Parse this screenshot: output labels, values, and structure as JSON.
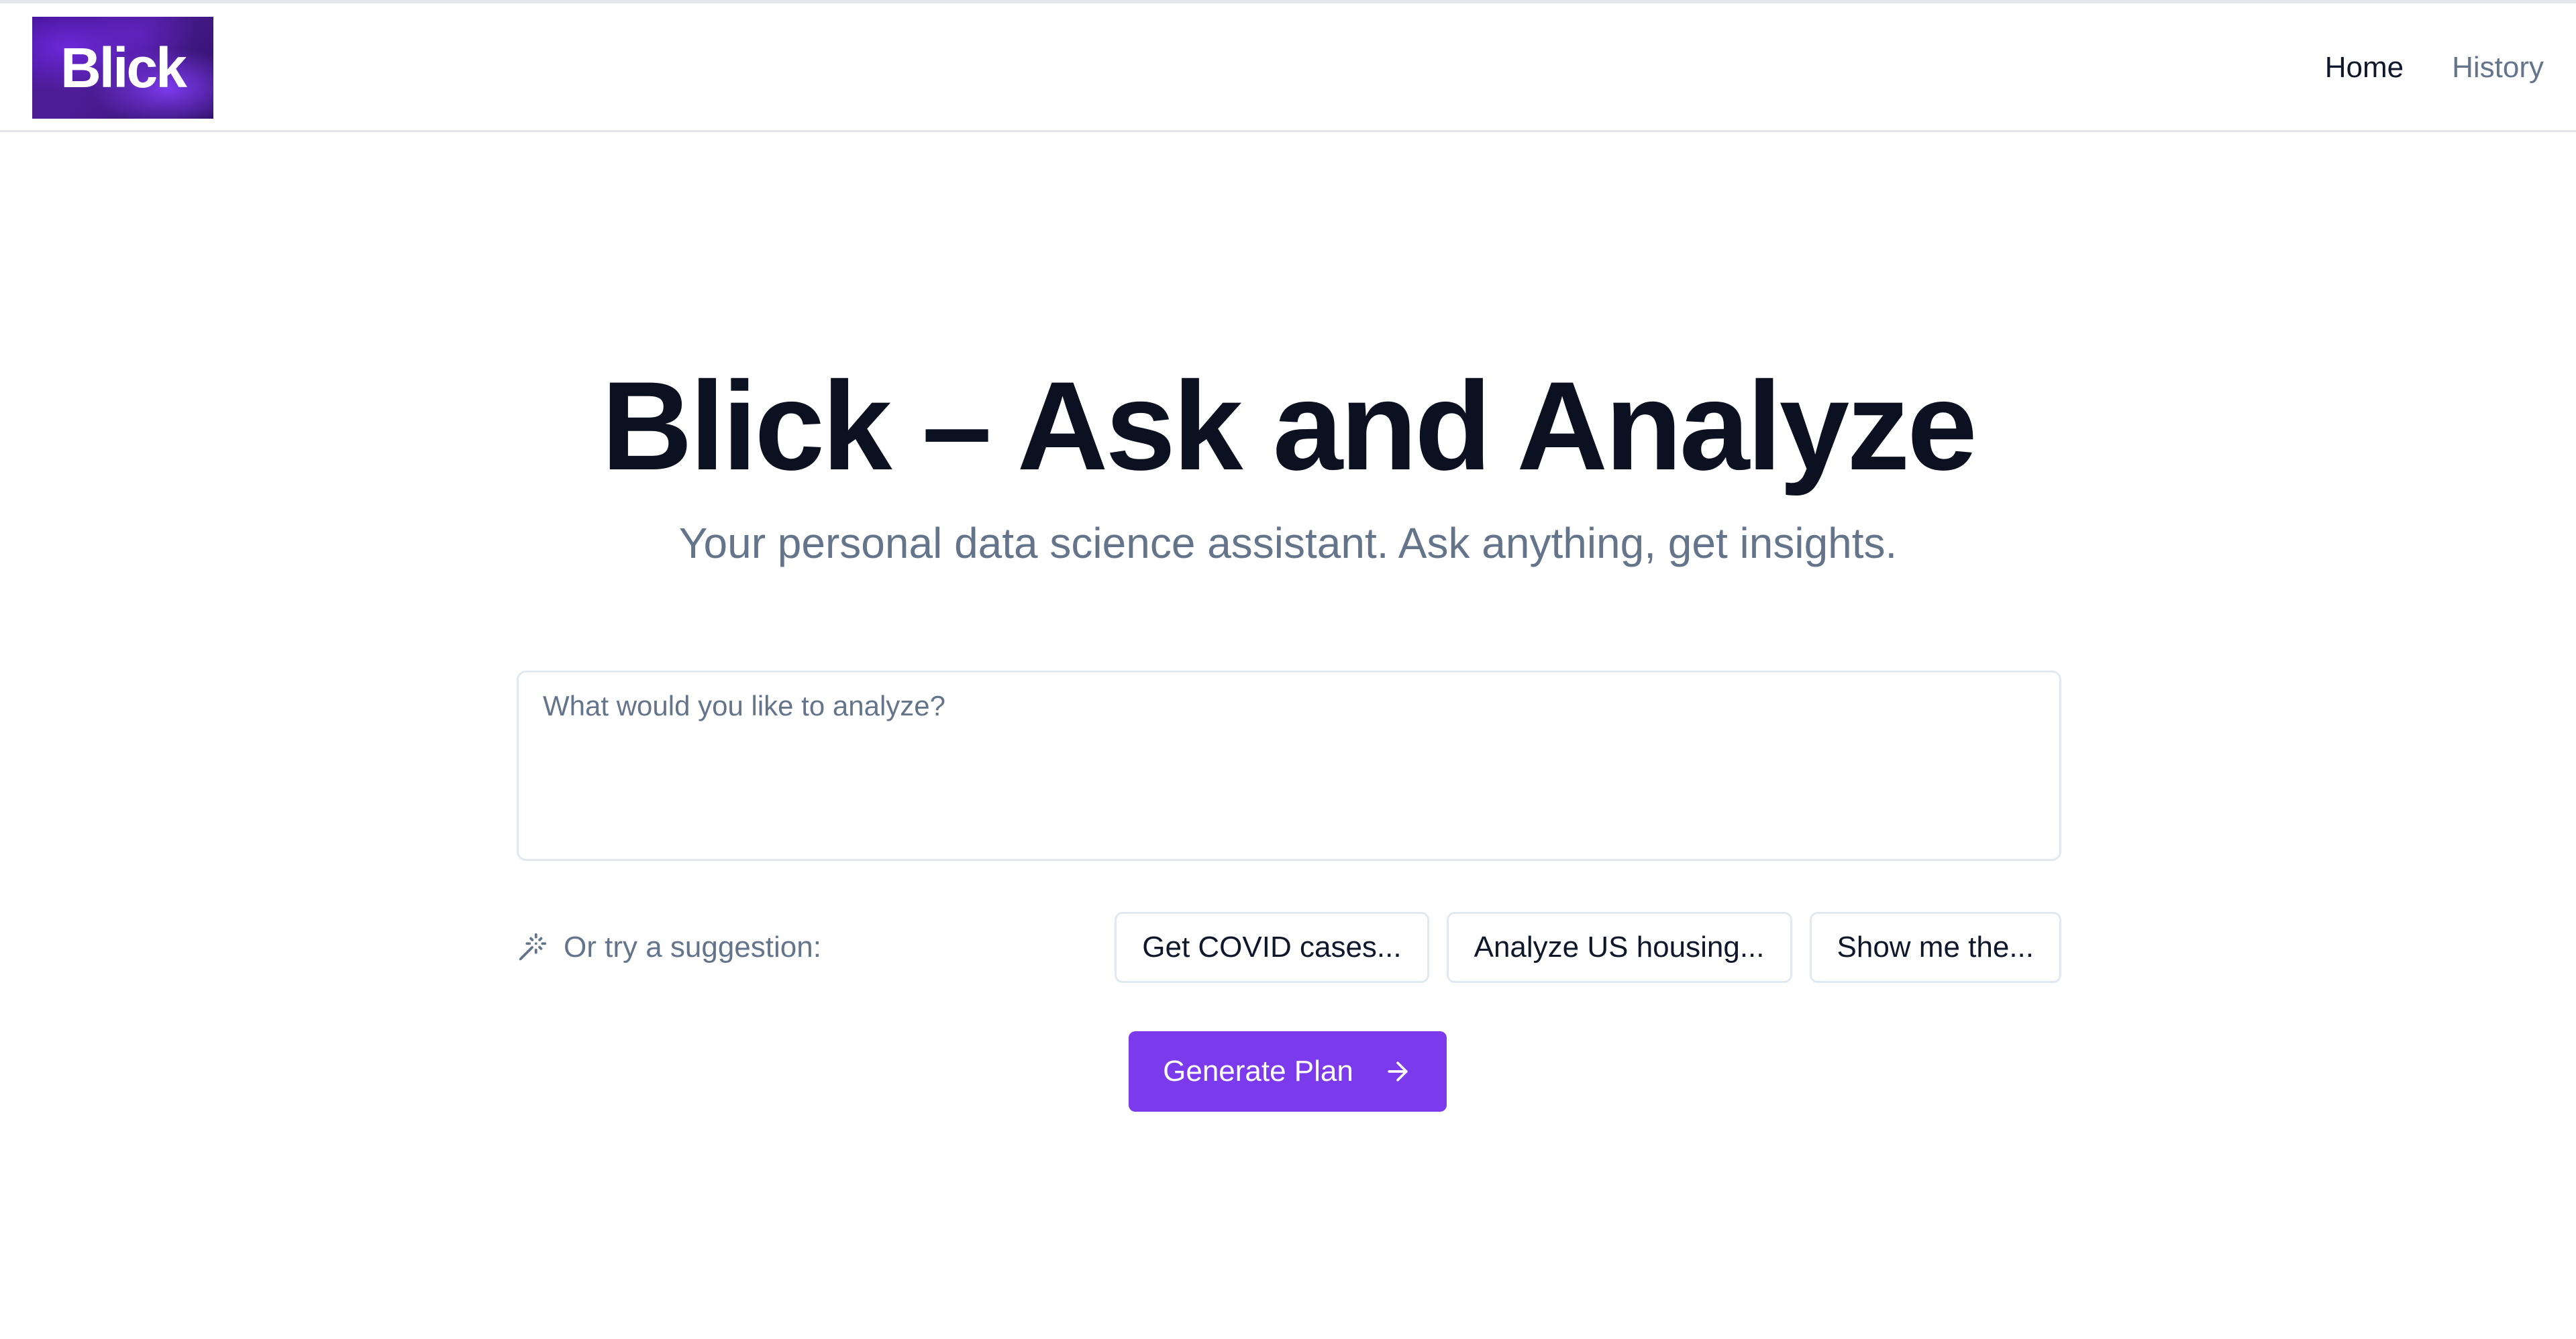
{
  "header": {
    "logo_text": "Blick",
    "nav": [
      {
        "label": "Home"
      },
      {
        "label": "History"
      }
    ]
  },
  "hero": {
    "title": "Blick – Ask and Analyze",
    "subtitle": "Your personal data science assistant. Ask anything, get insights."
  },
  "query": {
    "placeholder": "What would you like to analyze?",
    "value": ""
  },
  "suggestions": {
    "label": "Or try a suggestion:",
    "icon": "magic-wand-icon",
    "items": [
      {
        "label": "Get COVID cases..."
      },
      {
        "label": "Analyze US housing..."
      },
      {
        "label": "Show me the..."
      }
    ]
  },
  "actions": {
    "generate_label": "Generate Plan",
    "generate_icon": "arrow-right-icon"
  },
  "colors": {
    "accent": "#7c3aed",
    "muted_text": "#64748b",
    "border": "#e2e8f0",
    "title_text": "#0b1120"
  }
}
